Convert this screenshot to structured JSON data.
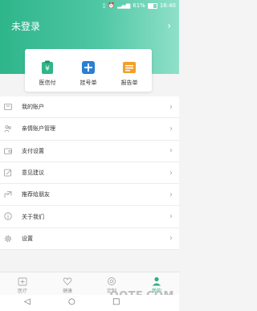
{
  "status_bar": {
    "battery": "61%",
    "time": "16:40"
  },
  "header": {
    "login_text": "未登录"
  },
  "quick_actions": [
    {
      "label": "医信付",
      "icon": "clipboard-pay-icon"
    },
    {
      "label": "挂号单",
      "icon": "plus-icon"
    },
    {
      "label": "报告单",
      "icon": "report-icon"
    }
  ],
  "menu": [
    {
      "label": "我的账户",
      "icon": "id-card-icon"
    },
    {
      "label": "亲情账户管理",
      "icon": "family-icon"
    },
    {
      "label": "支付设置",
      "icon": "wallet-icon"
    },
    {
      "label": "意见建议",
      "icon": "edit-icon"
    },
    {
      "label": "推荐给朋友",
      "icon": "share-icon"
    },
    {
      "label": "关于我们",
      "icon": "info-icon"
    },
    {
      "label": "设置",
      "icon": "gear-icon"
    }
  ],
  "tabs": [
    {
      "label": "医疗",
      "active": false
    },
    {
      "label": "健康",
      "active": false
    },
    {
      "label": "定制",
      "active": false
    },
    {
      "label": "我的",
      "active": true
    }
  ],
  "watermark": "QQTF.COM",
  "colors": {
    "primary": "#2fb58a",
    "active_tab": "#2fae86"
  }
}
